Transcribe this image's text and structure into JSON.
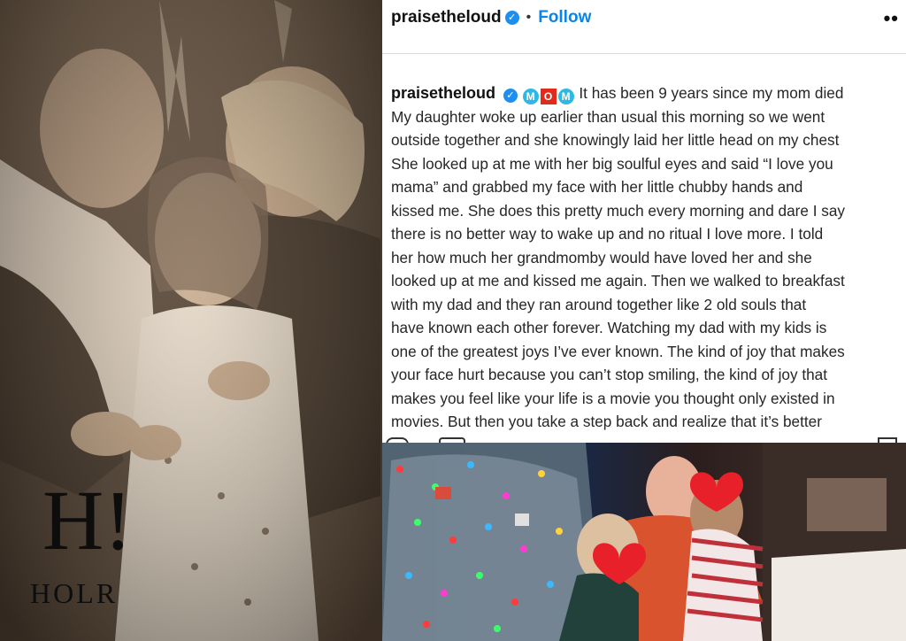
{
  "left_image": {
    "logo_mark": "H!",
    "logo_text": "HOLR",
    "icon": "vintage-family-photo"
  },
  "post": {
    "username": "praisetheloud",
    "verified_icon": "verified-badge-icon",
    "separator": "•",
    "follow_label": "Follow",
    "more_label": "••",
    "caption": {
      "username": "praisetheloud",
      "emoji": [
        "M",
        "O",
        "M"
      ],
      "lines": [
        "It has been 9 years since my mom died",
        "My daughter woke up earlier than usual this morning so we went",
        "outside together and she knowingly laid her little head on my chest",
        "She looked up at me with her big soulful eyes and said “I love you",
        "mama” and grabbed my face with her little chubby hands and",
        "kissed me. She does this pretty much every morning and dare I say",
        "there is no better way to wake up and no ritual I love more. I told",
        "her how much her grandmomby would have loved her and she",
        "looked up at me and kissed me again. Then we walked to breakfast",
        "with my dad and they ran around together like 2 old souls that",
        "have known each other forever. Watching my dad with my kids is",
        "one of the greatest joys I’ve ever known. The kind of joy that makes",
        "your face hurt because you can’t stop smiling, the kind of joy that",
        "makes you feel like your life is a movie you thought only existed in",
        "movies. But then you take a step back and realize that it’s better"
      ]
    },
    "colors": {
      "accent": "#0a84e8",
      "text": "#262626",
      "verified": "#1d8ff0"
    }
  },
  "bottom_image": {
    "icon": "christmas-tree-family-photo",
    "sticker_icon": "red-heart-icon"
  }
}
